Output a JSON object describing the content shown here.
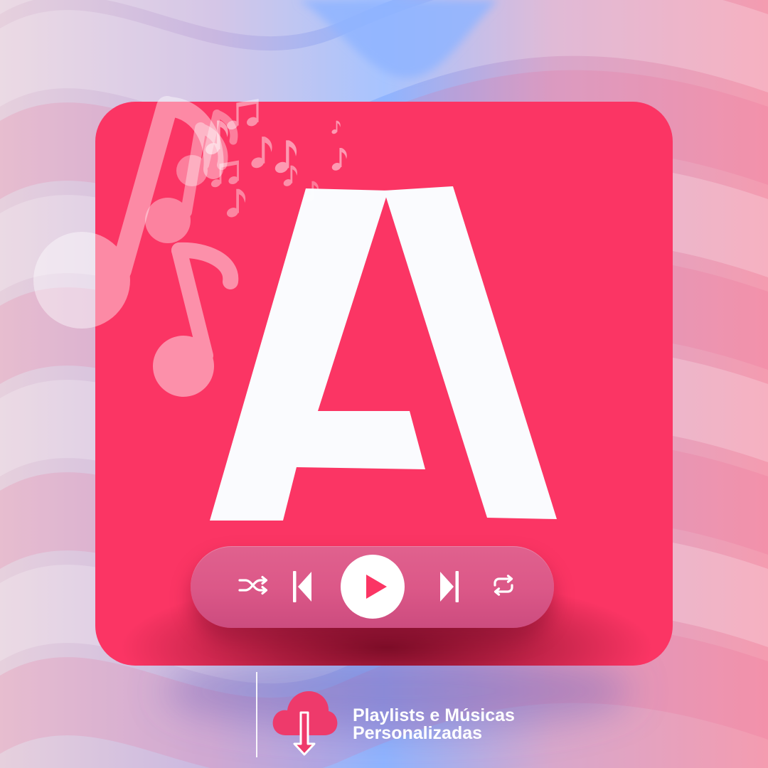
{
  "brand": {
    "logo_letter": "A"
  },
  "colors": {
    "card": "#FB3564",
    "player_bar": "#DC5888",
    "play_triangle": "#FB3564",
    "accent": "#EE3A6B",
    "icon": "#FFFFFF",
    "background_blue": "#8FB4FF",
    "background_pink": "#F49CB0",
    "background_lavender": "#E6D0DD"
  },
  "decor": {
    "icon": "music-note-icon"
  },
  "player": {
    "controls": [
      "shuffle-icon",
      "previous-icon",
      "play-icon",
      "next-icon",
      "repeat-icon"
    ]
  },
  "footer": {
    "icon": "cloud-download-icon",
    "tagline": [
      "Playlists e Músicas",
      "Personalizadas"
    ]
  }
}
